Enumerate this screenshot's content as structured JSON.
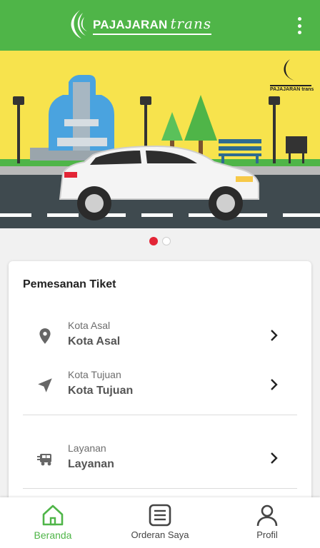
{
  "app": {
    "brand_primary": "PAJAJARAN",
    "brand_secondary": "trans",
    "colors": {
      "primary": "#4fb548",
      "accent_red": "#e32536"
    }
  },
  "banner": {
    "logo_text": "PAJAJARAN trans",
    "carousel_pages": 2,
    "active_page": 1
  },
  "booking": {
    "title": "Pemesanan Tiket",
    "origin": {
      "label": "Kota Asal",
      "value": "Kota Asal",
      "icon": "location-pin-icon"
    },
    "destination": {
      "label": "Kota Tujuan",
      "value": "Kota Tujuan",
      "icon": "navigation-arrow-icon"
    },
    "service": {
      "label": "Layanan",
      "value": "Layanan",
      "icon": "shuttle-icon"
    }
  },
  "nav": {
    "items": [
      {
        "label": "Beranda",
        "icon": "home-icon",
        "active": true
      },
      {
        "label": "Orderan Saya",
        "icon": "list-icon",
        "active": false
      },
      {
        "label": "Profil",
        "icon": "person-icon",
        "active": false
      }
    ]
  }
}
